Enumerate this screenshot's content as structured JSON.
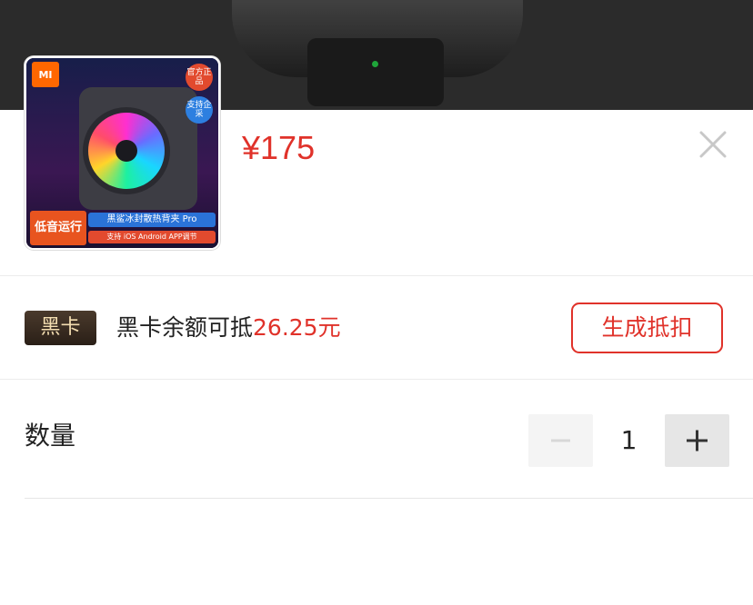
{
  "product": {
    "price": "¥175",
    "thumbnail": {
      "brand_mark": "MI",
      "badge_official": "官方正品",
      "badge_enterprise": "支持企采",
      "label_quiet": "低音运行",
      "label_name": "黑鲨冰封散热背夹 Pro",
      "label_support": "支持 iOS Android APP调节"
    }
  },
  "blackcard": {
    "tag": "黑卡",
    "text_prefix": "黑卡余额可抵",
    "amount": "26.25元",
    "button_label": "生成抵扣"
  },
  "quantity": {
    "label": "数量",
    "value": "1"
  },
  "icons": {
    "close": "close-icon",
    "minus": "minus-icon",
    "plus": "plus-icon"
  },
  "colors": {
    "accent": "#e0322a",
    "tag_bg": "#3a2d22",
    "tag_text": "#f3ddb0"
  }
}
